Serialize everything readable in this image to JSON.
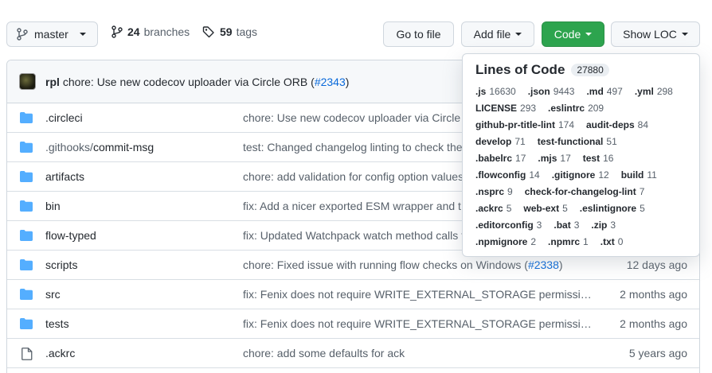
{
  "toolbar": {
    "branch_name": "master",
    "branches_count": "24",
    "branches_label": "branches",
    "tags_count": "59",
    "tags_label": "tags",
    "go_to_file": "Go to file",
    "add_file": "Add file",
    "code": "Code",
    "show_loc": "Show LOC"
  },
  "commit": {
    "author": "rpl",
    "message": "chore: Use new codecov uploader via Circle ORB (",
    "pr": "#2343",
    "close": ")"
  },
  "files": [
    {
      "type": "dir",
      "name": ".circleci",
      "name_muted": "",
      "message": "chore: Use new codecov uploader via Circle ORB",
      "age": ""
    },
    {
      "type": "dir",
      "name": "commit-msg",
      "name_muted": ".githooks/",
      "message": "test: Changed changelog linting to check the",
      "age": ""
    },
    {
      "type": "dir",
      "name": "artifacts",
      "name_muted": "",
      "message": "chore: add validation for config option values",
      "age": ""
    },
    {
      "type": "dir",
      "name": "bin",
      "name_muted": "",
      "message": "fix: Add a nicer exported ESM wrapper and t",
      "age": ""
    },
    {
      "type": "dir",
      "name": "flow-typed",
      "name_muted": "",
      "message": "fix: Updated Watchpack watch method calls t",
      "age": ""
    },
    {
      "type": "dir",
      "name": "scripts",
      "name_muted": "",
      "message": "chore: Fixed issue with running flow checks on Windows (",
      "pr": "#2338",
      "message_end": ")",
      "age": "12 days ago"
    },
    {
      "type": "dir",
      "name": "src",
      "name_muted": "",
      "message": "fix: Fenix does not require WRITE_EXTERNAL_STORAGE permissi…",
      "age": "2 months ago"
    },
    {
      "type": "dir",
      "name": "tests",
      "name_muted": "",
      "message": "fix: Fenix does not require WRITE_EXTERNAL_STORAGE permissi…",
      "age": "2 months ago"
    },
    {
      "type": "file",
      "name": ".ackrc",
      "name_muted": "",
      "message": "chore: add some defaults for ack",
      "age": "5 years ago"
    }
  ],
  "loc": {
    "title": "Lines of Code",
    "total": "27880",
    "items": [
      {
        "ext": ".js",
        "count": "16630"
      },
      {
        "ext": ".json",
        "count": "9443"
      },
      {
        "ext": ".md",
        "count": "497"
      },
      {
        "ext": ".yml",
        "count": "298"
      },
      {
        "ext": "LICENSE",
        "count": "293"
      },
      {
        "ext": ".eslintrc",
        "count": "209"
      },
      {
        "ext": "github-pr-title-lint",
        "count": "174"
      },
      {
        "ext": "audit-deps",
        "count": "84"
      },
      {
        "ext": "develop",
        "count": "71"
      },
      {
        "ext": "test-functional",
        "count": "51"
      },
      {
        "ext": ".babelrc",
        "count": "17"
      },
      {
        "ext": ".mjs",
        "count": "17"
      },
      {
        "ext": "test",
        "count": "16"
      },
      {
        "ext": ".flowconfig",
        "count": "14"
      },
      {
        "ext": ".gitignore",
        "count": "12"
      },
      {
        "ext": "build",
        "count": "11"
      },
      {
        "ext": ".nsprc",
        "count": "9"
      },
      {
        "ext": "check-for-changelog-lint",
        "count": "7"
      },
      {
        "ext": ".ackrc",
        "count": "5"
      },
      {
        "ext": "web-ext",
        "count": "5"
      },
      {
        "ext": ".eslintignore",
        "count": "5"
      },
      {
        "ext": ".editorconfig",
        "count": "3"
      },
      {
        "ext": ".bat",
        "count": "3"
      },
      {
        "ext": ".zip",
        "count": "3"
      },
      {
        "ext": ".npmignore",
        "count": "2"
      },
      {
        "ext": ".npmrc",
        "count": "1"
      },
      {
        "ext": ".txt",
        "count": "0"
      }
    ]
  },
  "colors": {
    "folder": "#54aeff",
    "link": "#0969da",
    "primary_button": "#2da44e"
  }
}
